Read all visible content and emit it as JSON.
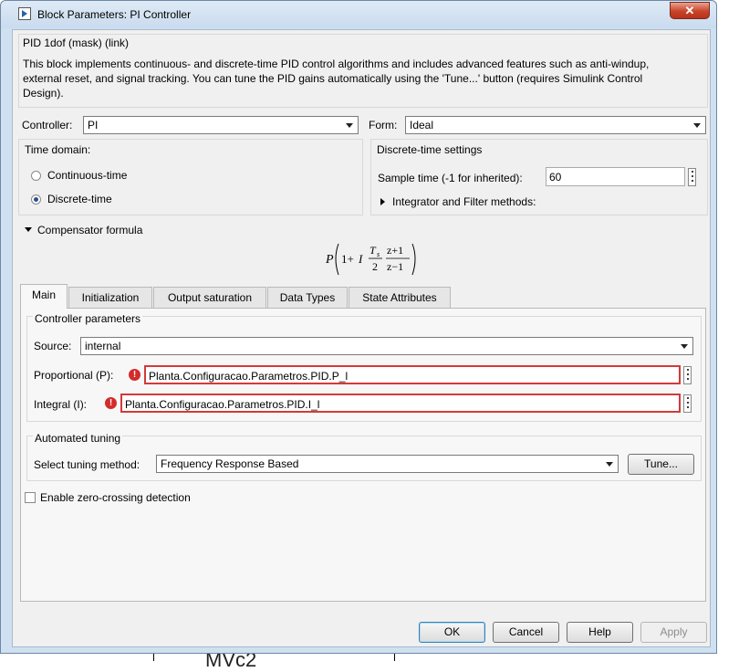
{
  "background": {
    "text": "MVc2"
  },
  "window": {
    "title": "Block Parameters: PI Controller",
    "close_label": "✕"
  },
  "mask": {
    "header": "PID 1dof (mask) (link)",
    "description": "This block implements continuous- and discrete-time PID control algorithms and includes advanced features such as anti-windup, external reset, and signal tracking. You can tune the PID gains automatically using the 'Tune...' button (requires Simulink Control Design)."
  },
  "controller": {
    "label": "Controller:",
    "value": "PI"
  },
  "form": {
    "label": "Form:",
    "value": "Ideal"
  },
  "time_domain": {
    "label": "Time domain:",
    "options": [
      {
        "label": "Continuous-time",
        "selected": false
      },
      {
        "label": "Discrete-time",
        "selected": true
      }
    ]
  },
  "discrete_settings": {
    "label": "Discrete-time settings",
    "sample_time_label": "Sample time (-1 for inherited):",
    "sample_time_value": "60",
    "integrator_label": "Integrator and Filter methods:"
  },
  "compensator": {
    "label": "Compensator formula",
    "formula": {
      "P": "P",
      "one_plus": "1+",
      "I": "I",
      "Ts": "T",
      "s": "s",
      "two": "2",
      "num": "z+1",
      "den": "z−1"
    }
  },
  "tabs": [
    {
      "label": "Main",
      "active": true
    },
    {
      "label": "Initialization",
      "active": false
    },
    {
      "label": "Output saturation",
      "active": false
    },
    {
      "label": "Data Types",
      "active": false
    },
    {
      "label": "State Attributes",
      "active": false
    }
  ],
  "controller_params": {
    "label": "Controller parameters",
    "source_label": "Source:",
    "source_value": "internal",
    "proportional_label": "Proportional (P):",
    "proportional_value": "Planta.Configuracao.Parametros.PID.P_l",
    "integral_label": "Integral (I):",
    "integral_value": "Planta.Configuracao.Parametros.PID.I_l",
    "error_glyph": "!"
  },
  "automated_tuning": {
    "label": "Automated tuning",
    "method_label": "Select tuning method:",
    "method_value": "Frequency Response Based",
    "tune_label": "Tune..."
  },
  "zero_crossing": {
    "label": "Enable zero-crossing detection",
    "checked": false
  },
  "buttons": {
    "ok": "OK",
    "cancel": "Cancel",
    "help": "Help",
    "apply": "Apply"
  },
  "colors": {
    "error": "#d42b2b",
    "accent": "#3c7fb1",
    "window_frame": "#cfe0f1"
  }
}
